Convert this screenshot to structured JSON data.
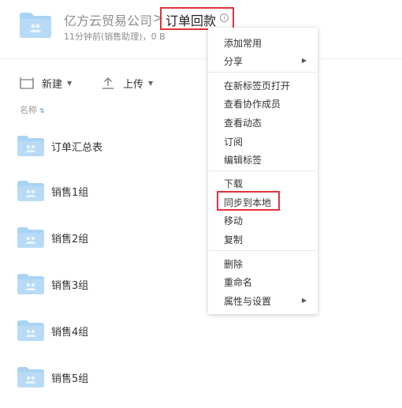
{
  "header": {
    "parent_folder": "亿方云贸易公司",
    "separator": ">",
    "current_folder": "订单回款",
    "info_glyph": "i",
    "meta": "11分钟前(销售助理)，0 B"
  },
  "toolbar": {
    "new_label": "新建",
    "upload_label": "上传",
    "dropdown_glyph": "▼"
  },
  "list": {
    "sort_label": "名称",
    "sort_glyph": "⇅",
    "files": [
      {
        "name": "订单汇总表"
      },
      {
        "name": "销售1组"
      },
      {
        "name": "销售2组"
      },
      {
        "name": "销售3组"
      },
      {
        "name": "销售4组"
      },
      {
        "name": "销售5组"
      }
    ]
  },
  "context_menu": {
    "submenu_glyph": "▶",
    "items": [
      {
        "label": "添加常用"
      },
      {
        "label": "分享"
      },
      {
        "label": "在新标签页打开"
      },
      {
        "label": "查看协作成员"
      },
      {
        "label": "查看动态"
      },
      {
        "label": "订阅"
      },
      {
        "label": "编辑标签"
      },
      {
        "label": "下载"
      },
      {
        "label": "同步到本地"
      },
      {
        "label": "移动"
      },
      {
        "label": "复制"
      },
      {
        "label": "删除"
      },
      {
        "label": "重命名"
      },
      {
        "label": "属性与设置"
      }
    ]
  },
  "colors": {
    "folder": "#a9d3f3",
    "folder_tab": "#8fc3ec",
    "highlight": "#e0333b"
  },
  "icons": [
    "folder-icon",
    "info-icon",
    "new-icon",
    "upload-icon",
    "caret-down-icon",
    "sort-icon",
    "submenu-arrow-icon"
  ]
}
